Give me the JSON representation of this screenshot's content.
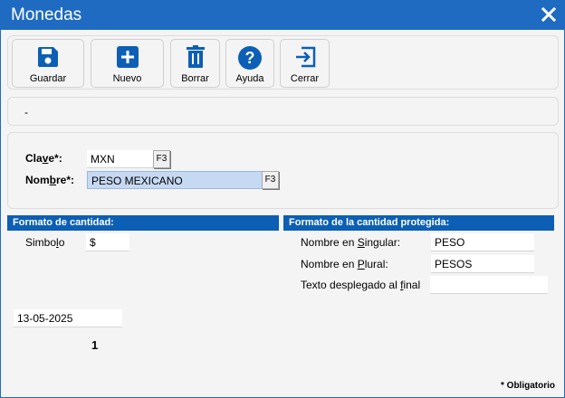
{
  "window": {
    "title": "Monedas",
    "close_icon": "close-icon"
  },
  "toolbar": {
    "save_label": "Guardar",
    "new_label": "Nuevo",
    "delete_label": "Borrar",
    "help_label": "Ayuda",
    "close_label": "Cerrar"
  },
  "message": {
    "text": "-"
  },
  "form": {
    "clave_label_pre": "Cla",
    "clave_label_u": "v",
    "clave_label_post": "e*:",
    "clave_value": "MXN",
    "nombre_label_pre": "Nom",
    "nombre_label_u": "b",
    "nombre_label_post": "re*:",
    "nombre_value": "PESO MEXICANO",
    "f3_label": "F3"
  },
  "formato_cantidad": {
    "header": "Formato de cantidad:",
    "simbolo_label_pre": "Simbo",
    "simbolo_label_u": "l",
    "simbolo_label_post": "o",
    "simbolo_value": "$"
  },
  "formato_protegida": {
    "header": "Formato de la cantidad protegida:",
    "singular_label_pre": "Nombre en ",
    "singular_label_u": "S",
    "singular_label_post": "ingular:",
    "singular_value": "PESO",
    "plural_label_pre": "Nombre en ",
    "plural_label_u": "P",
    "plural_label_post": "lural:",
    "plural_value": "PESOS",
    "final_label_pre": "Texto desplegado al ",
    "final_label_u": "f",
    "final_label_post": "inal",
    "final_value": ""
  },
  "footer": {
    "date": "13-05-2025",
    "count": "1",
    "obligatorio": "* Obligatorio"
  },
  "colors": {
    "titlebar": "#1e6bc1",
    "section_header": "#0c5fb5",
    "icon": "#0c5fb5"
  }
}
